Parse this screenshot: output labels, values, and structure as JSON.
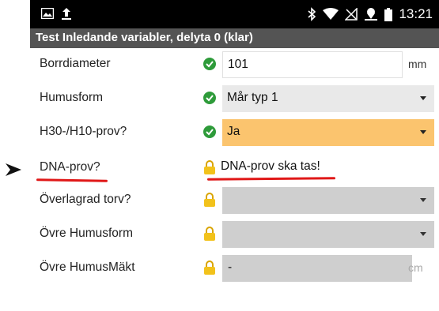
{
  "status_bar": {
    "time": "13:21",
    "left_icons": [
      "image-icon",
      "upload-icon"
    ],
    "right_icons": [
      "bluetooth-icon",
      "wifi-icon",
      "no-sim-icon",
      "location-icon",
      "battery-icon"
    ]
  },
  "title_bar": {
    "title": "Test Inledande variabler, delyta 0 (klar)"
  },
  "rows": [
    {
      "label": "Borrdiameter",
      "status": "ok",
      "value": "101",
      "unit": "mm"
    },
    {
      "label": "Humusform",
      "status": "ok",
      "value": "Mår typ 1"
    },
    {
      "label": "H30-/H10-prov?",
      "status": "ok",
      "value": "Ja",
      "highlight": "#fbc46e"
    },
    {
      "label": "DNA-prov?",
      "status": "locked",
      "message": "DNA-prov ska tas!"
    },
    {
      "label": "Överlagrad torv?",
      "status": "locked",
      "value": ""
    },
    {
      "label": "Övre Humusform",
      "status": "locked",
      "value": ""
    },
    {
      "label": "Övre HumusMäkt",
      "status": "locked",
      "value": "-",
      "unit": "cm"
    }
  ],
  "colors": {
    "ok": "#2e9b3a",
    "lock": "#f2c21b",
    "title_bar": "#545454",
    "annotation": "#e01818"
  }
}
